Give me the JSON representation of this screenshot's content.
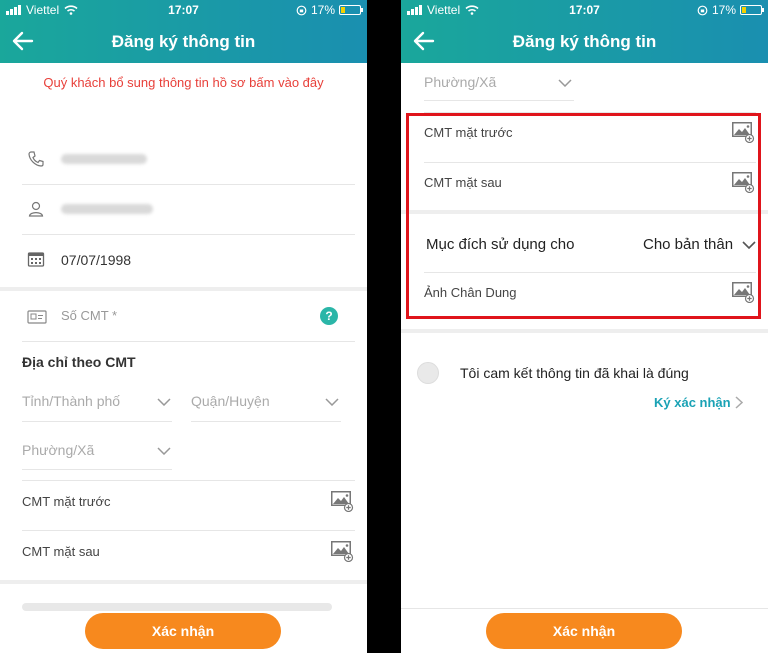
{
  "status_bar": {
    "carrier": "Viettel",
    "time": "17:07",
    "battery": "17%"
  },
  "header": {
    "title": "Đăng ký thông tin"
  },
  "left": {
    "notice": "Quý khách bổ sung thông tin hồ sơ bấm vào đây",
    "birthdate": "07/07/1998",
    "id_number_placeholder": "Số CMT *",
    "address_title": "Địa chỉ theo CMT",
    "province_placeholder": "Tỉnh/Thành phố",
    "district_placeholder": "Quận/Huyện",
    "ward_placeholder": "Phường/Xã",
    "id_front": "CMT mặt trước",
    "id_back": "CMT mặt sau",
    "confirm_button": "Xác nhận"
  },
  "right": {
    "ward_placeholder": "Phường/Xã",
    "id_front": "CMT mặt trước",
    "id_back": "CMT mặt sau",
    "purpose_label": "Mục đích sử dụng cho",
    "purpose_value": "Cho bản thân",
    "portrait": "Ảnh Chân Dung",
    "commit_text": "Tôi cam kết thông tin đã khai là đúng",
    "sign_link": "Ký xác nhận",
    "confirm_button": "Xác nhận"
  }
}
